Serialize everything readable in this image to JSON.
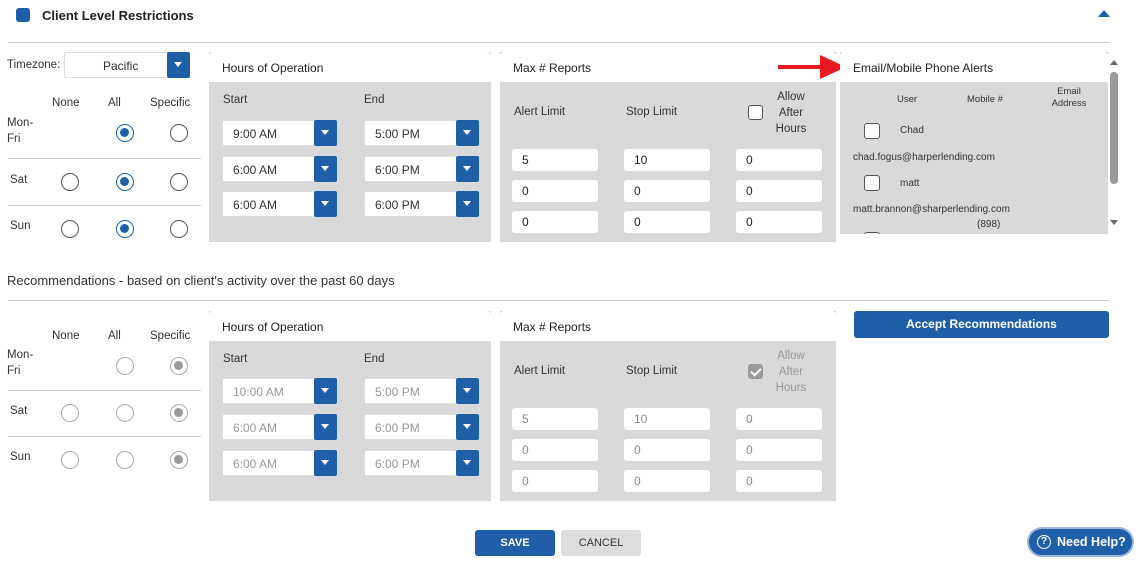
{
  "header": {
    "title": "Client Level Restrictions"
  },
  "timezone": {
    "label": "Timezone:",
    "value": "Pacific"
  },
  "radio_headers": {
    "none": "None",
    "all": "All",
    "specific": "Specific"
  },
  "days": {
    "monfri": "Mon-Fri",
    "sat": "Sat",
    "sun": "Sun"
  },
  "hours": {
    "title": "Hours of Operation",
    "start": "Start",
    "end": "End",
    "rows": [
      {
        "start": "9:00 AM",
        "end": "5:00 PM"
      },
      {
        "start": "6:00 AM",
        "end": "6:00 PM"
      },
      {
        "start": "6:00 AM",
        "end": "6:00 PM"
      }
    ]
  },
  "reports": {
    "title": "Max # Reports",
    "alert": "Alert Limit",
    "stop": "Stop Limit",
    "allow": "Allow After Hours",
    "rows": [
      {
        "a": "5",
        "s": "10",
        "h": "0"
      },
      {
        "a": "0",
        "s": "0",
        "h": "0"
      },
      {
        "a": "0",
        "s": "0",
        "h": "0"
      }
    ]
  },
  "alerts": {
    "title": "Email/Mobile Phone Alerts",
    "col_user": "User",
    "col_mobile": "Mobile #",
    "col_email": "Email Address",
    "users": [
      {
        "name": "Chad",
        "email": "chad.fogus@harperlending.com",
        "mobile": ""
      },
      {
        "name": "matt",
        "email": "matt.brannon@sharperlending.com",
        "mobile": "(898)"
      }
    ]
  },
  "recommend": {
    "title": "Recommendations - based on client's activity over the past 60 days",
    "hours": [
      {
        "start": "10:00 AM",
        "end": "5:00 PM"
      },
      {
        "start": "6:00 AM",
        "end": "6:00 PM"
      },
      {
        "start": "6:00 AM",
        "end": "6:00 PM"
      }
    ],
    "reports": [
      {
        "a": "5",
        "s": "10",
        "h": "0"
      },
      {
        "a": "0",
        "s": "0",
        "h": "0"
      },
      {
        "a": "0",
        "s": "0",
        "h": "0"
      }
    ],
    "accept": "Accept Recommendations"
  },
  "buttons": {
    "save": "SAVE",
    "cancel": "CANCEL",
    "help": "Need Help?"
  },
  "colors": {
    "accent": "#1f5fa8",
    "arrow": "#e8191f"
  }
}
